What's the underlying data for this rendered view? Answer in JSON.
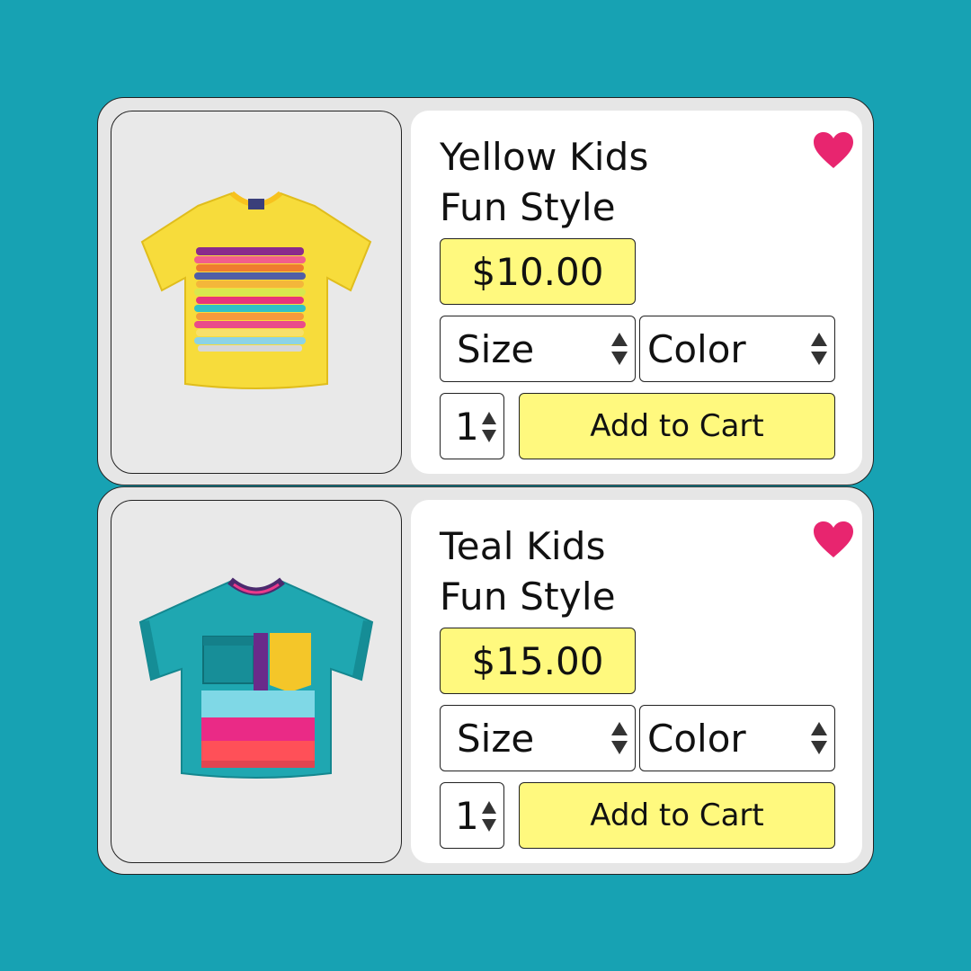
{
  "products": [
    {
      "title_line1": "Yellow Kids",
      "title_line2": "Fun Style",
      "price": "$10.00",
      "size_label": "Size",
      "color_label": "Color",
      "quantity": "1",
      "add_to_cart_label": "Add to Cart",
      "image_icon": "yellow-tshirt-image",
      "favorited": true
    },
    {
      "title_line1": "Teal Kids",
      "title_line2": "Fun Style",
      "price": "$15.00",
      "size_label": "Size",
      "color_label": "Color",
      "quantity": "1",
      "add_to_cart_label": "Add to Cart",
      "image_icon": "teal-tshirt-image",
      "favorited": true
    }
  ],
  "colors": {
    "background": "#17a2b3",
    "card": "#e6e6e6",
    "accent_yellow": "#fff97e",
    "heart": "#e8256f"
  }
}
